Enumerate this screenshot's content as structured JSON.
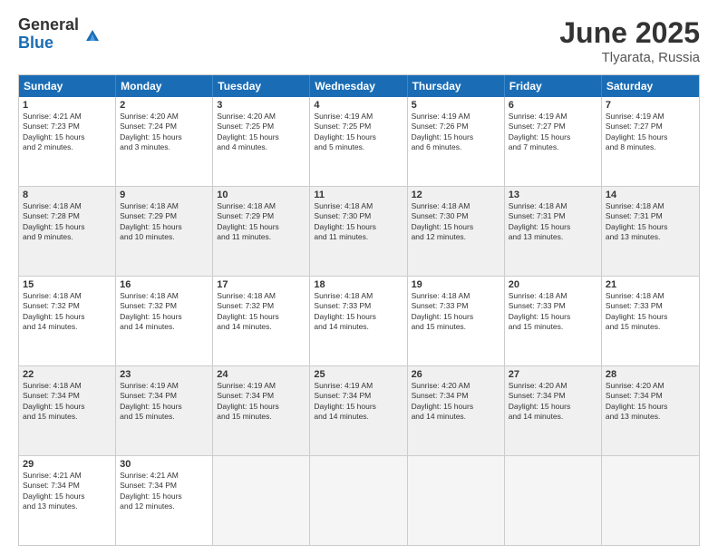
{
  "logo": {
    "general": "General",
    "blue": "Blue"
  },
  "title": {
    "month": "June 2025",
    "location": "Tlyarata, Russia"
  },
  "header_days": [
    "Sunday",
    "Monday",
    "Tuesday",
    "Wednesday",
    "Thursday",
    "Friday",
    "Saturday"
  ],
  "rows": [
    [
      {
        "day": "1",
        "lines": [
          "Sunrise: 4:21 AM",
          "Sunset: 7:23 PM",
          "Daylight: 15 hours",
          "and 2 minutes."
        ]
      },
      {
        "day": "2",
        "lines": [
          "Sunrise: 4:20 AM",
          "Sunset: 7:24 PM",
          "Daylight: 15 hours",
          "and 3 minutes."
        ]
      },
      {
        "day": "3",
        "lines": [
          "Sunrise: 4:20 AM",
          "Sunset: 7:25 PM",
          "Daylight: 15 hours",
          "and 4 minutes."
        ]
      },
      {
        "day": "4",
        "lines": [
          "Sunrise: 4:19 AM",
          "Sunset: 7:25 PM",
          "Daylight: 15 hours",
          "and 5 minutes."
        ]
      },
      {
        "day": "5",
        "lines": [
          "Sunrise: 4:19 AM",
          "Sunset: 7:26 PM",
          "Daylight: 15 hours",
          "and 6 minutes."
        ]
      },
      {
        "day": "6",
        "lines": [
          "Sunrise: 4:19 AM",
          "Sunset: 7:27 PM",
          "Daylight: 15 hours",
          "and 7 minutes."
        ]
      },
      {
        "day": "7",
        "lines": [
          "Sunrise: 4:19 AM",
          "Sunset: 7:27 PM",
          "Daylight: 15 hours",
          "and 8 minutes."
        ]
      }
    ],
    [
      {
        "day": "8",
        "lines": [
          "Sunrise: 4:18 AM",
          "Sunset: 7:28 PM",
          "Daylight: 15 hours",
          "and 9 minutes."
        ]
      },
      {
        "day": "9",
        "lines": [
          "Sunrise: 4:18 AM",
          "Sunset: 7:29 PM",
          "Daylight: 15 hours",
          "and 10 minutes."
        ]
      },
      {
        "day": "10",
        "lines": [
          "Sunrise: 4:18 AM",
          "Sunset: 7:29 PM",
          "Daylight: 15 hours",
          "and 11 minutes."
        ]
      },
      {
        "day": "11",
        "lines": [
          "Sunrise: 4:18 AM",
          "Sunset: 7:30 PM",
          "Daylight: 15 hours",
          "and 11 minutes."
        ]
      },
      {
        "day": "12",
        "lines": [
          "Sunrise: 4:18 AM",
          "Sunset: 7:30 PM",
          "Daylight: 15 hours",
          "and 12 minutes."
        ]
      },
      {
        "day": "13",
        "lines": [
          "Sunrise: 4:18 AM",
          "Sunset: 7:31 PM",
          "Daylight: 15 hours",
          "and 13 minutes."
        ]
      },
      {
        "day": "14",
        "lines": [
          "Sunrise: 4:18 AM",
          "Sunset: 7:31 PM",
          "Daylight: 15 hours",
          "and 13 minutes."
        ]
      }
    ],
    [
      {
        "day": "15",
        "lines": [
          "Sunrise: 4:18 AM",
          "Sunset: 7:32 PM",
          "Daylight: 15 hours",
          "and 14 minutes."
        ]
      },
      {
        "day": "16",
        "lines": [
          "Sunrise: 4:18 AM",
          "Sunset: 7:32 PM",
          "Daylight: 15 hours",
          "and 14 minutes."
        ]
      },
      {
        "day": "17",
        "lines": [
          "Sunrise: 4:18 AM",
          "Sunset: 7:32 PM",
          "Daylight: 15 hours",
          "and 14 minutes."
        ]
      },
      {
        "day": "18",
        "lines": [
          "Sunrise: 4:18 AM",
          "Sunset: 7:33 PM",
          "Daylight: 15 hours",
          "and 14 minutes."
        ]
      },
      {
        "day": "19",
        "lines": [
          "Sunrise: 4:18 AM",
          "Sunset: 7:33 PM",
          "Daylight: 15 hours",
          "and 15 minutes."
        ]
      },
      {
        "day": "20",
        "lines": [
          "Sunrise: 4:18 AM",
          "Sunset: 7:33 PM",
          "Daylight: 15 hours",
          "and 15 minutes."
        ]
      },
      {
        "day": "21",
        "lines": [
          "Sunrise: 4:18 AM",
          "Sunset: 7:33 PM",
          "Daylight: 15 hours",
          "and 15 minutes."
        ]
      }
    ],
    [
      {
        "day": "22",
        "lines": [
          "Sunrise: 4:18 AM",
          "Sunset: 7:34 PM",
          "Daylight: 15 hours",
          "and 15 minutes."
        ]
      },
      {
        "day": "23",
        "lines": [
          "Sunrise: 4:19 AM",
          "Sunset: 7:34 PM",
          "Daylight: 15 hours",
          "and 15 minutes."
        ]
      },
      {
        "day": "24",
        "lines": [
          "Sunrise: 4:19 AM",
          "Sunset: 7:34 PM",
          "Daylight: 15 hours",
          "and 15 minutes."
        ]
      },
      {
        "day": "25",
        "lines": [
          "Sunrise: 4:19 AM",
          "Sunset: 7:34 PM",
          "Daylight: 15 hours",
          "and 14 minutes."
        ]
      },
      {
        "day": "26",
        "lines": [
          "Sunrise: 4:20 AM",
          "Sunset: 7:34 PM",
          "Daylight: 15 hours",
          "and 14 minutes."
        ]
      },
      {
        "day": "27",
        "lines": [
          "Sunrise: 4:20 AM",
          "Sunset: 7:34 PM",
          "Daylight: 15 hours",
          "and 14 minutes."
        ]
      },
      {
        "day": "28",
        "lines": [
          "Sunrise: 4:20 AM",
          "Sunset: 7:34 PM",
          "Daylight: 15 hours",
          "and 13 minutes."
        ]
      }
    ],
    [
      {
        "day": "29",
        "lines": [
          "Sunrise: 4:21 AM",
          "Sunset: 7:34 PM",
          "Daylight: 15 hours",
          "and 13 minutes."
        ]
      },
      {
        "day": "30",
        "lines": [
          "Sunrise: 4:21 AM",
          "Sunset: 7:34 PM",
          "Daylight: 15 hours",
          "and 12 minutes."
        ]
      },
      {
        "day": "",
        "lines": [],
        "empty": true
      },
      {
        "day": "",
        "lines": [],
        "empty": true
      },
      {
        "day": "",
        "lines": [],
        "empty": true
      },
      {
        "day": "",
        "lines": [],
        "empty": true
      },
      {
        "day": "",
        "lines": [],
        "empty": true
      }
    ]
  ]
}
